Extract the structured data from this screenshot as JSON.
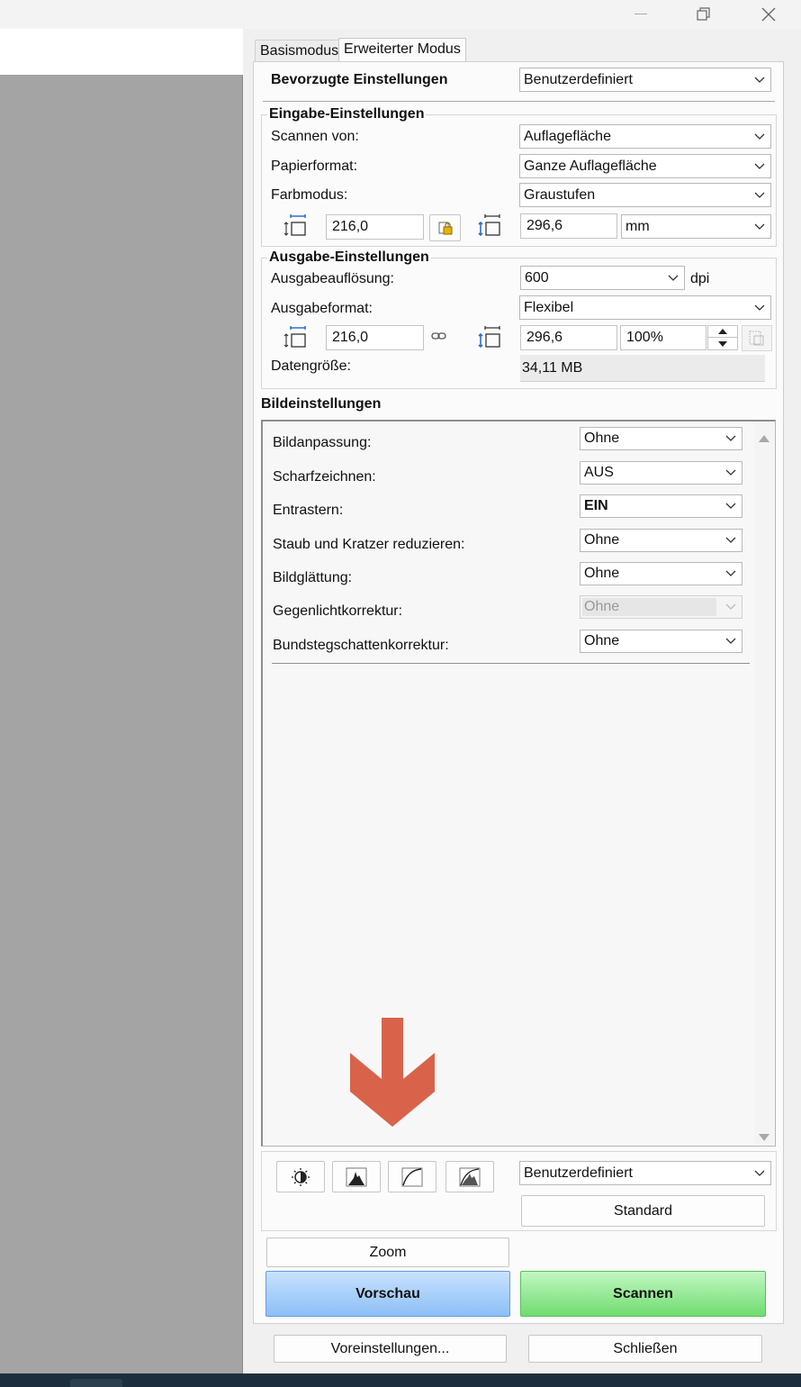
{
  "window": {
    "minimize_icon": "minimize-icon",
    "restore_icon": "restore-icon",
    "close_icon": "close-icon"
  },
  "tabs": [
    {
      "label": "Basismodus",
      "active": false
    },
    {
      "label": "Erweiterter Modus",
      "active": true
    }
  ],
  "preferred": {
    "label": "Bevorzugte Einstellungen",
    "value": "Benutzerdefiniert"
  },
  "input_settings": {
    "title": "Eingabe-Einstellungen",
    "scan_from": {
      "label": "Scannen von:",
      "value": "Auflagefläche"
    },
    "paper_format": {
      "label": "Papierformat:",
      "value": "Ganze Auflagefläche"
    },
    "color_mode": {
      "label": "Farbmodus:",
      "value": "Graustufen"
    },
    "width": "216,0",
    "height": "296,6",
    "unit": "mm"
  },
  "output_settings": {
    "title": "Ausgabe-Einstellungen",
    "resolution": {
      "label": "Ausgabeauflösung:",
      "value": "600",
      "unit": "dpi"
    },
    "format": {
      "label": "Ausgabeformat:",
      "value": "Flexibel"
    },
    "width": "216,0",
    "height": "296,6",
    "scale": "100%",
    "data_size": {
      "label": "Datengröße:",
      "value": "34,11 MB"
    }
  },
  "image_settings": {
    "title": "Bildeinstellungen",
    "rows": [
      {
        "label": "Bildanpassung:",
        "value": "Ohne",
        "bold": false,
        "disabled": false
      },
      {
        "label": "Scharfzeichnen:",
        "value": "AUS",
        "bold": false,
        "disabled": false
      },
      {
        "label": "Entrastern:",
        "value": "EIN",
        "bold": true,
        "disabled": false
      },
      {
        "label": "Staub und Kratzer reduzieren:",
        "value": "Ohne",
        "bold": false,
        "disabled": false
      },
      {
        "label": "Bildglättung:",
        "value": "Ohne",
        "bold": false,
        "disabled": false
      },
      {
        "label": "Gegenlichtkorrektur:",
        "value": "Ohne",
        "bold": false,
        "disabled": true
      },
      {
        "label": "Bundstegschattenkorrektur:",
        "value": "Ohne",
        "bold": false,
        "disabled": false
      }
    ],
    "annotation_arrow_color": "#d9634a"
  },
  "tools": {
    "icons": [
      "brightness-contrast-icon",
      "histogram-icon",
      "tone-curve-icon",
      "tone-histogram-icon"
    ],
    "preset": "Benutzerdefiniert",
    "standard_label": "Standard"
  },
  "actions": {
    "zoom": "Zoom",
    "preview": "Vorschau",
    "scan": "Scannen",
    "presets": "Voreinstellungen...",
    "close": "Schließen"
  },
  "colors": {
    "preview_button": "#8cbff5",
    "scan_button": "#6fdc6f",
    "arrow": "#d9634a"
  }
}
